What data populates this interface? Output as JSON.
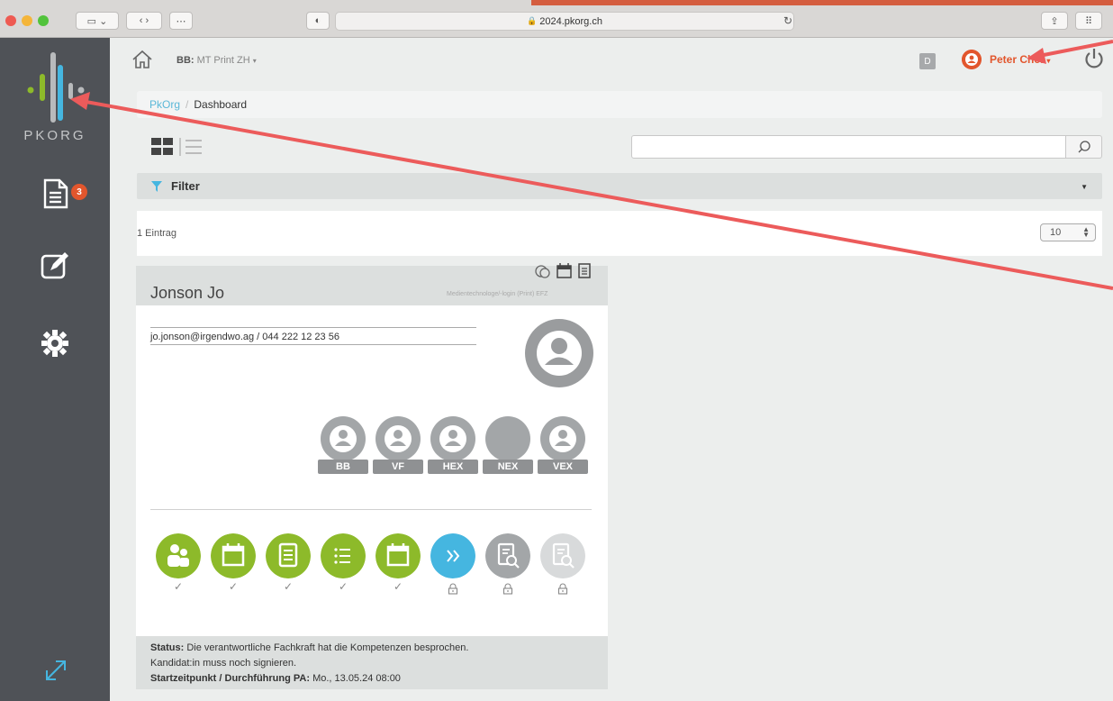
{
  "browser": {
    "url": "2024.pkorg.ch"
  },
  "sidebar": {
    "logo_text": "PKORG",
    "badge_count": "3",
    "items": [
      {
        "icon": "document-list-icon"
      },
      {
        "icon": "edit-icon"
      },
      {
        "icon": "gear-icon"
      },
      {
        "icon": "expand-icon"
      }
    ]
  },
  "topbar": {
    "org_label": "BB:",
    "org_value": "MT Print ZH",
    "d_label": "D",
    "user_name": "Peter Chef"
  },
  "breadcrumb": {
    "root": "PkOrg",
    "separator": "/",
    "current": "Dashboard"
  },
  "filter": {
    "label": "Filter"
  },
  "entries": {
    "count_text": "1 Eintrag",
    "page_size": "10"
  },
  "card": {
    "name": "Jonson Jo",
    "profession": "Medientechnologe/-login (Print) EFZ",
    "contact": "jo.jonson@irgendwo.ag / 044 222 12 23 56",
    "roles": [
      "BB",
      "VF",
      "HEX",
      "NEX",
      "VEX"
    ],
    "steps": [
      {
        "icon": "people-icon",
        "state": "done",
        "mark": "✓"
      },
      {
        "icon": "calendar-icon",
        "state": "done",
        "mark": "✓"
      },
      {
        "icon": "document-icon",
        "state": "done",
        "mark": "✓"
      },
      {
        "icon": "list-icon",
        "state": "done",
        "mark": "✓"
      },
      {
        "icon": "calendar-icon",
        "state": "done",
        "mark": "✓"
      },
      {
        "icon": "forward-icon",
        "state": "active",
        "mark": "lock"
      },
      {
        "icon": "document-search-icon",
        "state": "locked",
        "mark": "lock"
      },
      {
        "icon": "document-search-icon",
        "state": "locked-light",
        "mark": "lock"
      }
    ],
    "status_label": "Status:",
    "status_text": "Die verantwortliche Fachkraft hat die Kompetenzen besprochen.",
    "status_line2": "Kandidat:in muss noch signieren.",
    "start_label": "Startzeitpunkt / Durchführung PA:",
    "start_value": "Mo., 13.05.24 08:00"
  },
  "colors": {
    "sidebar": "#4f5257",
    "accent_orange": "#e2562d",
    "accent_blue": "#5bb8d8",
    "step_green": "#8dba2a",
    "step_blue": "#45b6e0",
    "step_grey": "#a3a6a8",
    "step_light": "#d8dadb",
    "annotation_red": "#ec5b5b"
  }
}
